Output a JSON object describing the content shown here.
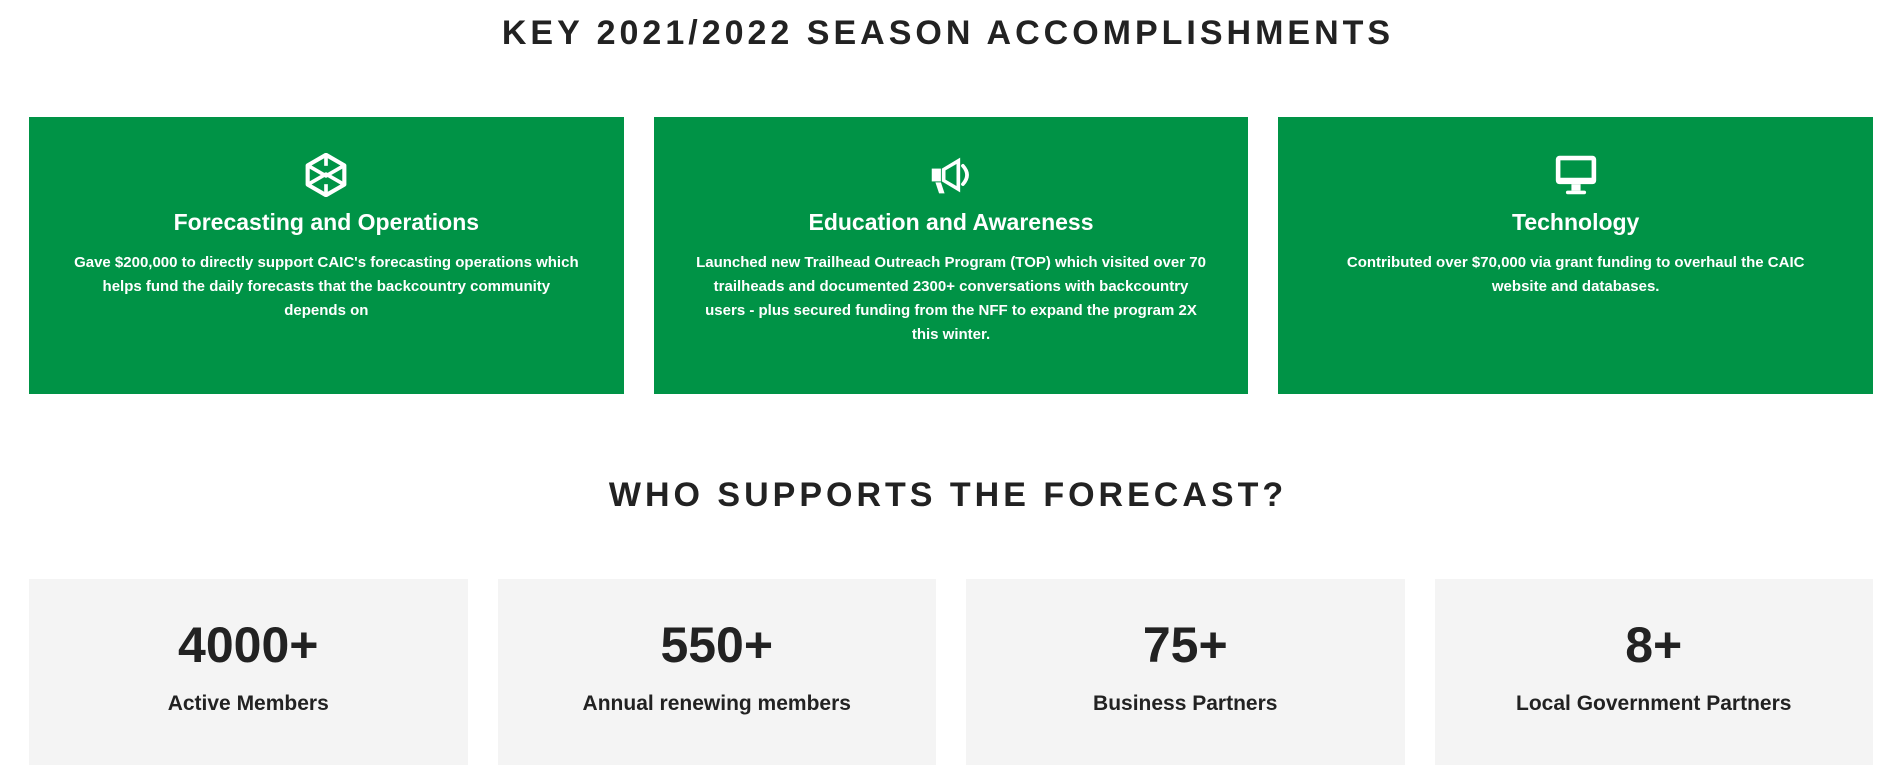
{
  "accomplishments": {
    "title": "KEY 2021/2022 SEASON ACCOMPLISHMENTS",
    "cards": [
      {
        "icon": "codepen-cube-icon",
        "title": "Forecasting and Operations",
        "text": "Gave $200,000 to directly support CAIC's forecasting operations which helps fund the daily forecasts that the backcountry community depends on"
      },
      {
        "icon": "megaphone-icon",
        "title": "Education and Awareness",
        "text": "Launched new Trailhead Outreach Program (TOP) which visited over 70 trailheads and documented 2300+ conversations with backcountry users - plus secured funding from the NFF to expand the program 2X this winter."
      },
      {
        "icon": "desktop-monitor-icon",
        "title": "Technology",
        "text": "Contributed over $70,000 via grant funding to overhaul the CAIC website and databases."
      }
    ]
  },
  "supporters": {
    "title": "WHO SUPPORTS THE FORECAST?",
    "stats": [
      {
        "value": "4000+",
        "label": "Active Members"
      },
      {
        "value": "550+",
        "label": "Annual renewing members"
      },
      {
        "value": "75+",
        "label": "Business Partners"
      },
      {
        "value": "8+",
        "label": "Local Government Partners"
      }
    ]
  },
  "colors": {
    "card_green": "#009346",
    "stat_background": "#f4f4f4",
    "text_dark": "#222222",
    "text_light": "#ffffff"
  }
}
